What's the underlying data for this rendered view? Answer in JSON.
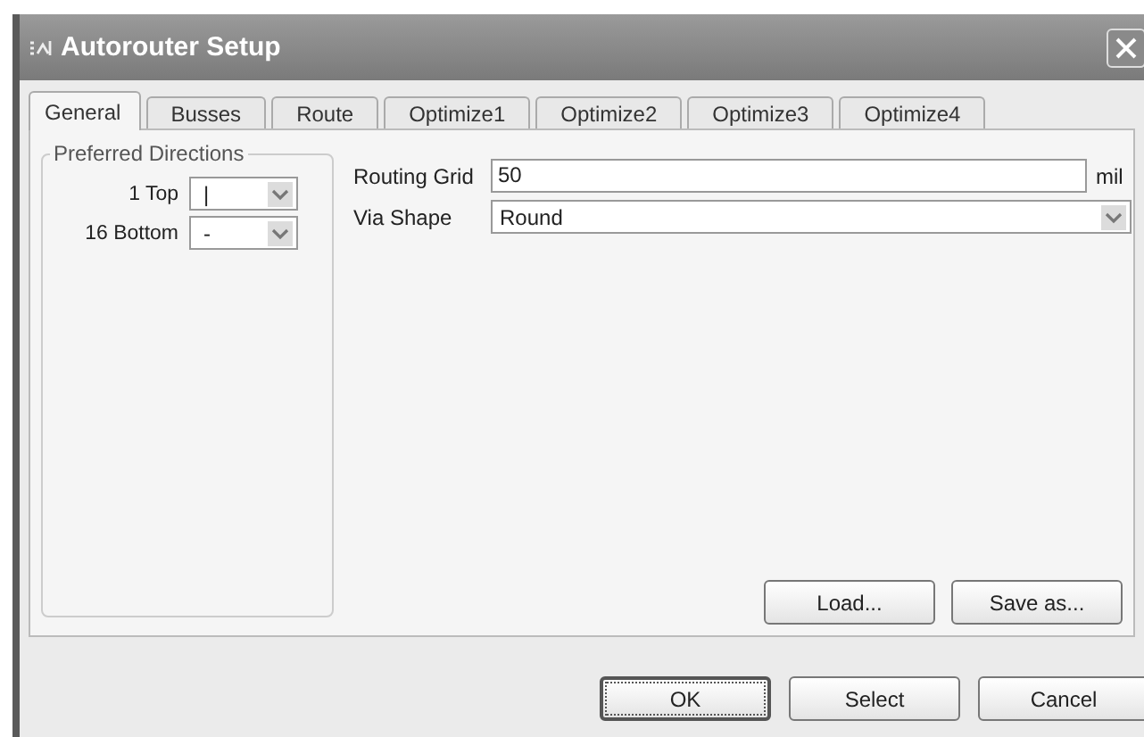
{
  "window": {
    "title": "Autorouter Setup"
  },
  "tabs": [
    {
      "label": "General",
      "selected": true
    },
    {
      "label": "Busses",
      "selected": false
    },
    {
      "label": "Route",
      "selected": false
    },
    {
      "label": "Optimize1",
      "selected": false
    },
    {
      "label": "Optimize2",
      "selected": false
    },
    {
      "label": "Optimize3",
      "selected": false
    },
    {
      "label": "Optimize4",
      "selected": false
    }
  ],
  "preferred_directions": {
    "title": "Preferred Directions",
    "layers": [
      {
        "label": "1 Top",
        "value": "|"
      },
      {
        "label": "16 Bottom",
        "value": "-"
      }
    ]
  },
  "routing_grid": {
    "label": "Routing Grid",
    "value": "50",
    "unit": "mil"
  },
  "via_shape": {
    "label": "Via Shape",
    "value": "Round"
  },
  "panel_buttons": [
    {
      "label": "Load..."
    },
    {
      "label": "Save as..."
    }
  ],
  "dialog_buttons": [
    {
      "label": "OK",
      "default": true
    },
    {
      "label": "Select",
      "default": false
    },
    {
      "label": "Cancel",
      "default": false
    }
  ]
}
